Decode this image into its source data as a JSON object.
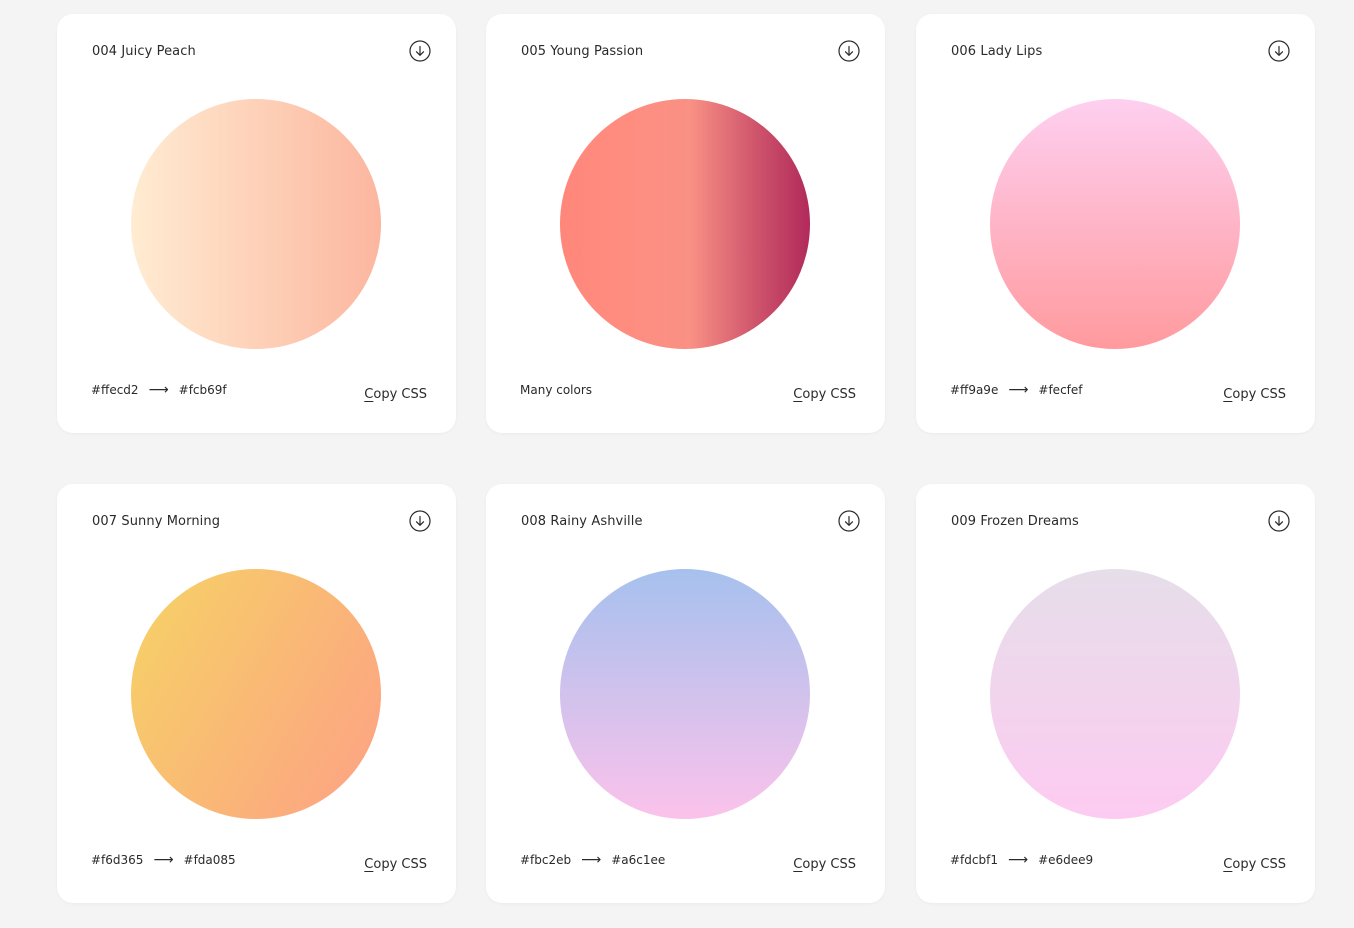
{
  "gradients": [
    {
      "title": "004 Juicy Peach",
      "from": "#ffecd2",
      "to": "#fcb69f",
      "colors_label": "",
      "copy_label": "Copy CSS",
      "arrow": "⟶",
      "css": "linear-gradient(to right, #ffecd2 0%, #fcb69f 100%)"
    },
    {
      "title": "005 Young Passion",
      "from": "",
      "to": "",
      "colors_label": "Many colors",
      "copy_label": "Copy CSS",
      "arrow": "",
      "css": "linear-gradient(to right, #ff8177 0%, #ff867a 0%, #ff8c7f 21%, #f99185 52%, #cf556c 78%, #b12a5b 100%)"
    },
    {
      "title": "006 Lady Lips",
      "from": "#ff9a9e",
      "to": "#fecfef",
      "colors_label": "",
      "copy_label": "Copy CSS",
      "arrow": "⟶",
      "css": "linear-gradient(to top, #ff9a9e 0%, #fecfef 99%, #fecfef 100%)"
    },
    {
      "title": "007 Sunny Morning",
      "from": "#f6d365",
      "to": "#fda085",
      "colors_label": "",
      "copy_label": "Copy CSS",
      "arrow": "⟶",
      "css": "linear-gradient(120deg, #f6d365 0%, #fda085 100%)"
    },
    {
      "title": "008 Rainy Ashville",
      "from": "#fbc2eb",
      "to": "#a6c1ee",
      "colors_label": "",
      "copy_label": "Copy CSS",
      "arrow": "⟶",
      "css": "linear-gradient(to top, #fbc2eb 0%, #a6c1ee 100%)"
    },
    {
      "title": "009 Frozen Dreams",
      "from": "#fdcbf1",
      "to": "#e6dee9",
      "colors_label": "",
      "copy_label": "Copy CSS",
      "arrow": "⟶",
      "css": "linear-gradient(to top, #fdcbf1 0%, #fdcbf1 1%, #e6dee9 100%)"
    }
  ],
  "icons": {
    "download": "download-icon"
  },
  "colors": {
    "page_background": "#f4f4f4",
    "card_background": "#ffffff",
    "text": "#2a2a2a"
  }
}
